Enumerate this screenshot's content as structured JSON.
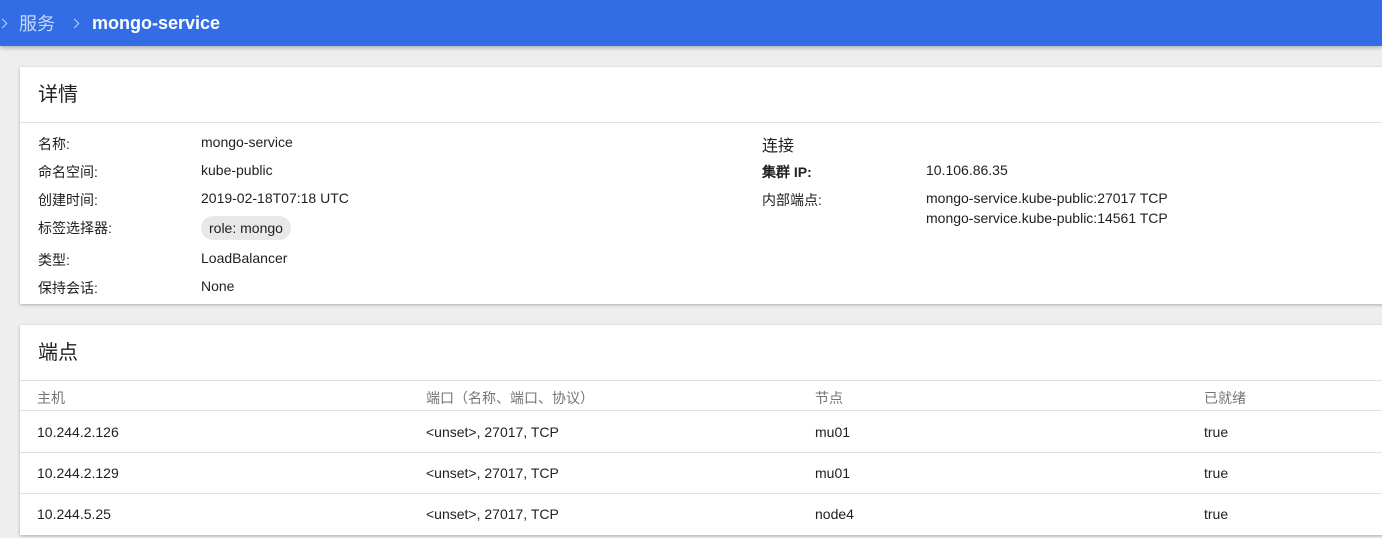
{
  "breadcrumb": {
    "parent": "服务",
    "current": "mongo-service"
  },
  "details": {
    "title": "详情",
    "fields": [
      {
        "label": "名称:",
        "value": "mongo-service"
      },
      {
        "label": "命名空间:",
        "value": "kube-public"
      },
      {
        "label": "创建时间:",
        "value": "2019-02-18T07:18 UTC"
      },
      {
        "label": "标签选择器:",
        "value": "role: mongo"
      },
      {
        "label": "类型:",
        "value": "LoadBalancer"
      },
      {
        "label": "保持会话:",
        "value": "None"
      }
    ],
    "connection": {
      "title": "连接",
      "cluster_ip_label": "集群 IP:",
      "cluster_ip": "10.106.86.35",
      "internal_endpoints_label": "内部端点:",
      "internal_endpoints": [
        "mongo-service.kube-public:27017 TCP",
        "mongo-service.kube-public:14561 TCP"
      ]
    }
  },
  "endpoints": {
    "title": "端点",
    "columns": [
      "主机",
      "端口（名称、端口、协议）",
      "节点",
      "已就绪"
    ],
    "rows": [
      [
        "10.244.2.126",
        "<unset>, 27017, TCP",
        "mu01",
        "true"
      ],
      [
        "10.244.2.129",
        "<unset>, 27017, TCP",
        "mu01",
        "true"
      ],
      [
        "10.244.5.25",
        "<unset>, 27017, TCP",
        "node4",
        "true"
      ]
    ]
  },
  "colors": {
    "topbar": "#326de6",
    "background": "#eeeeee",
    "chip": "#e8e8e8"
  }
}
